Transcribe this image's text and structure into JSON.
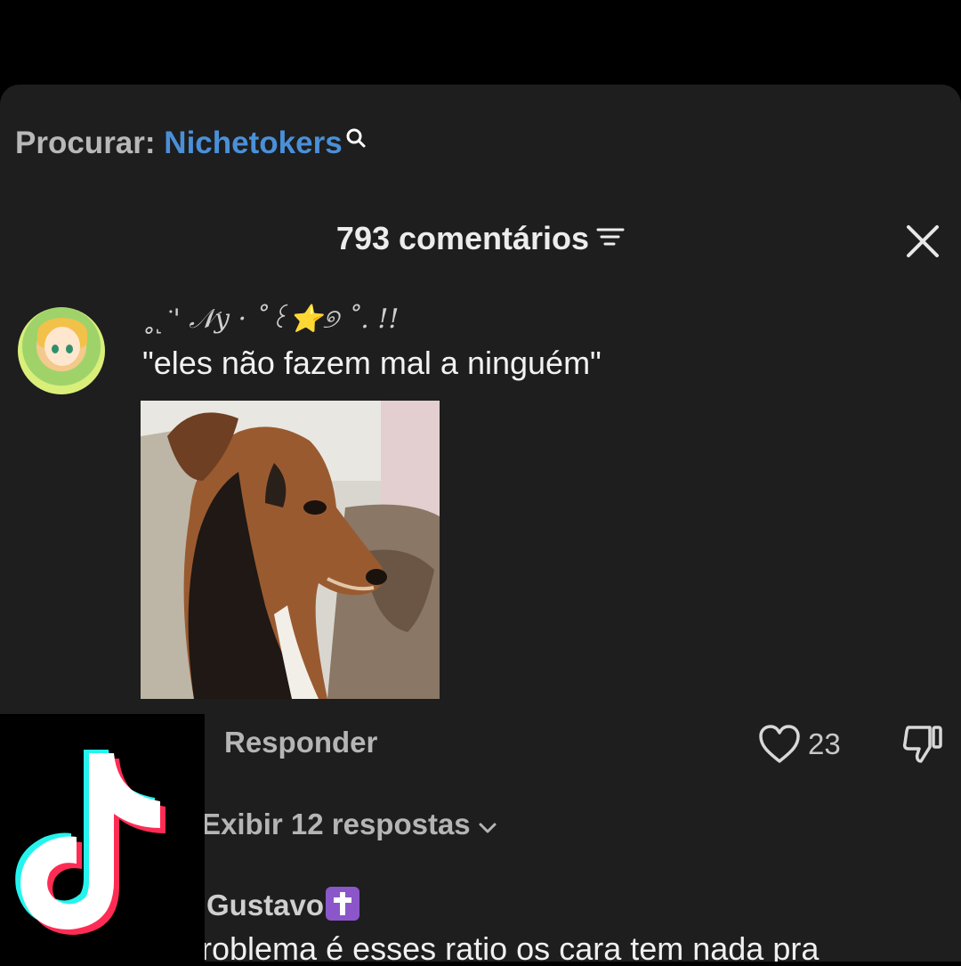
{
  "search": {
    "prefix": "Procurar:",
    "term": "Nichetokers"
  },
  "header": {
    "title": "793 comentários"
  },
  "comment": {
    "username": "˳˻̇ ' 𝒩y · ˚꒰⭐୭ ˚. !!",
    "text": "\"eles não fazem mal a ninguém\"",
    "reply_label": "Responder",
    "like_count": "23",
    "view_replies_label": "Exibir 12 respostas"
  },
  "comment2": {
    "username": "Gustavo",
    "text": "roblema é esses ratio os cara tem nada pra"
  },
  "colors": {
    "sheet_bg": "#1e1e1e",
    "search_accent": "#4a90d9",
    "tiktok_cyan": "#25f4ee",
    "tiktok_red": "#fe2c55"
  },
  "icons": [
    "search-icon",
    "filter-icon",
    "close-icon",
    "heart-icon",
    "dislike-icon",
    "chevron-down-icon",
    "cross-badge-icon",
    "tiktok-logo"
  ]
}
